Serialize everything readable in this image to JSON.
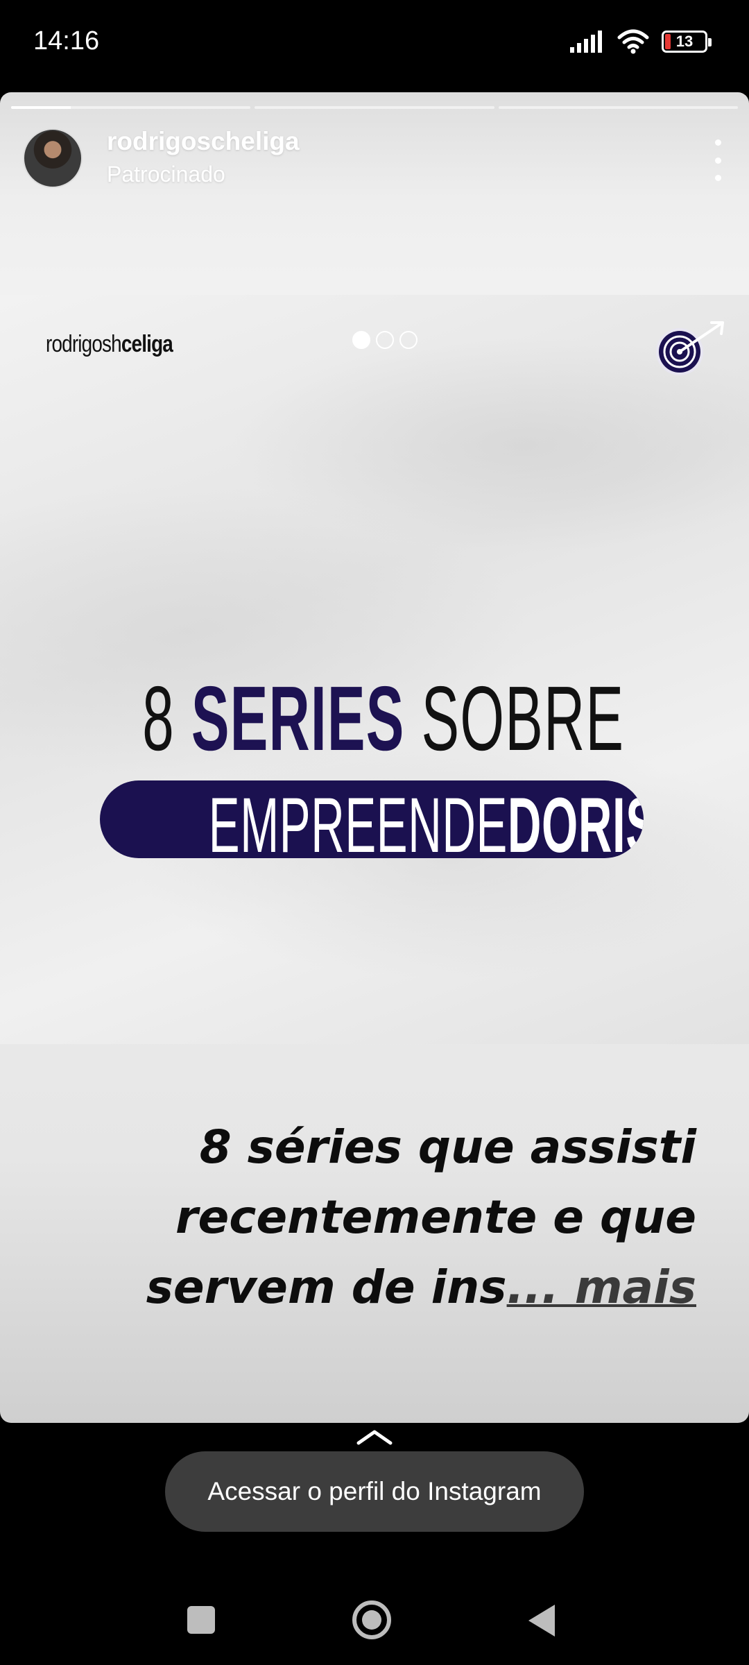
{
  "status_bar": {
    "time": "14:16",
    "battery": "13",
    "icons": [
      "signal-icon",
      "wifi-icon",
      "battery-icon"
    ]
  },
  "story": {
    "progress_segments": 3,
    "progress_current": 0.25,
    "username": "rodrigoscheliga",
    "sponsored": "Patrocinado"
  },
  "ad": {
    "brand_light": "rodrigosh",
    "brand_bold": "celiga",
    "headline_pre": "8 ",
    "headline_bold": "SERIES",
    "headline_post": " SOBRE",
    "headline2_light": "EMPREENDE",
    "headline2_bold": "DORISMO",
    "next_badge": ">>>",
    "carousel_count": 3,
    "carousel_active": 0
  },
  "caption": {
    "text": "8 séries que assisti recentemente e que servem de ins",
    "more": "... mais"
  },
  "cta": {
    "label": "Acessar o perfil do Instagram"
  },
  "colors": {
    "accent_navy": "#1b1150",
    "cta_bg": "#3d3d3d"
  }
}
